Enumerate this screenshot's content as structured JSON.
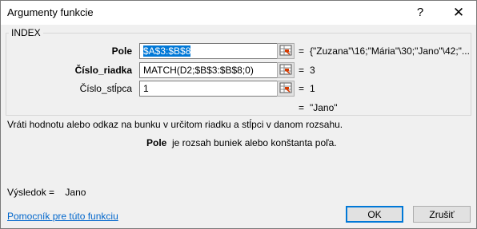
{
  "window": {
    "title": "Argumenty funkcie",
    "help_glyph": "?",
    "close_glyph": "✕"
  },
  "function_group": {
    "name": "INDEX",
    "args": [
      {
        "label": "Pole",
        "value": "$A$3:$B$8",
        "result": "{\"Zuzana\"\\16;\"Mária\"\\30;\"Jano\"\\42;\"..."
      },
      {
        "label": "Číslo_riadka",
        "value": "MATCH(D2;$B$3:$B$8;0)",
        "result": "3"
      },
      {
        "label": "Číslo_stĺpca",
        "value": "1",
        "result": "1"
      }
    ],
    "equals_sign": "=",
    "formula_result": "\"Jano\""
  },
  "description": "Vráti hodnotu alebo odkaz na bunku v určitom riadku a stĺpci v danom rozsahu.",
  "arg_description": {
    "name": "Pole",
    "text": "je rozsah buniek alebo konštanta poľa."
  },
  "result_row": {
    "label": "Výsledok =",
    "value": "Jano"
  },
  "help_link": "Pomocník pre túto funkciu",
  "buttons": {
    "ok": "OK",
    "cancel": "Zrušiť"
  }
}
